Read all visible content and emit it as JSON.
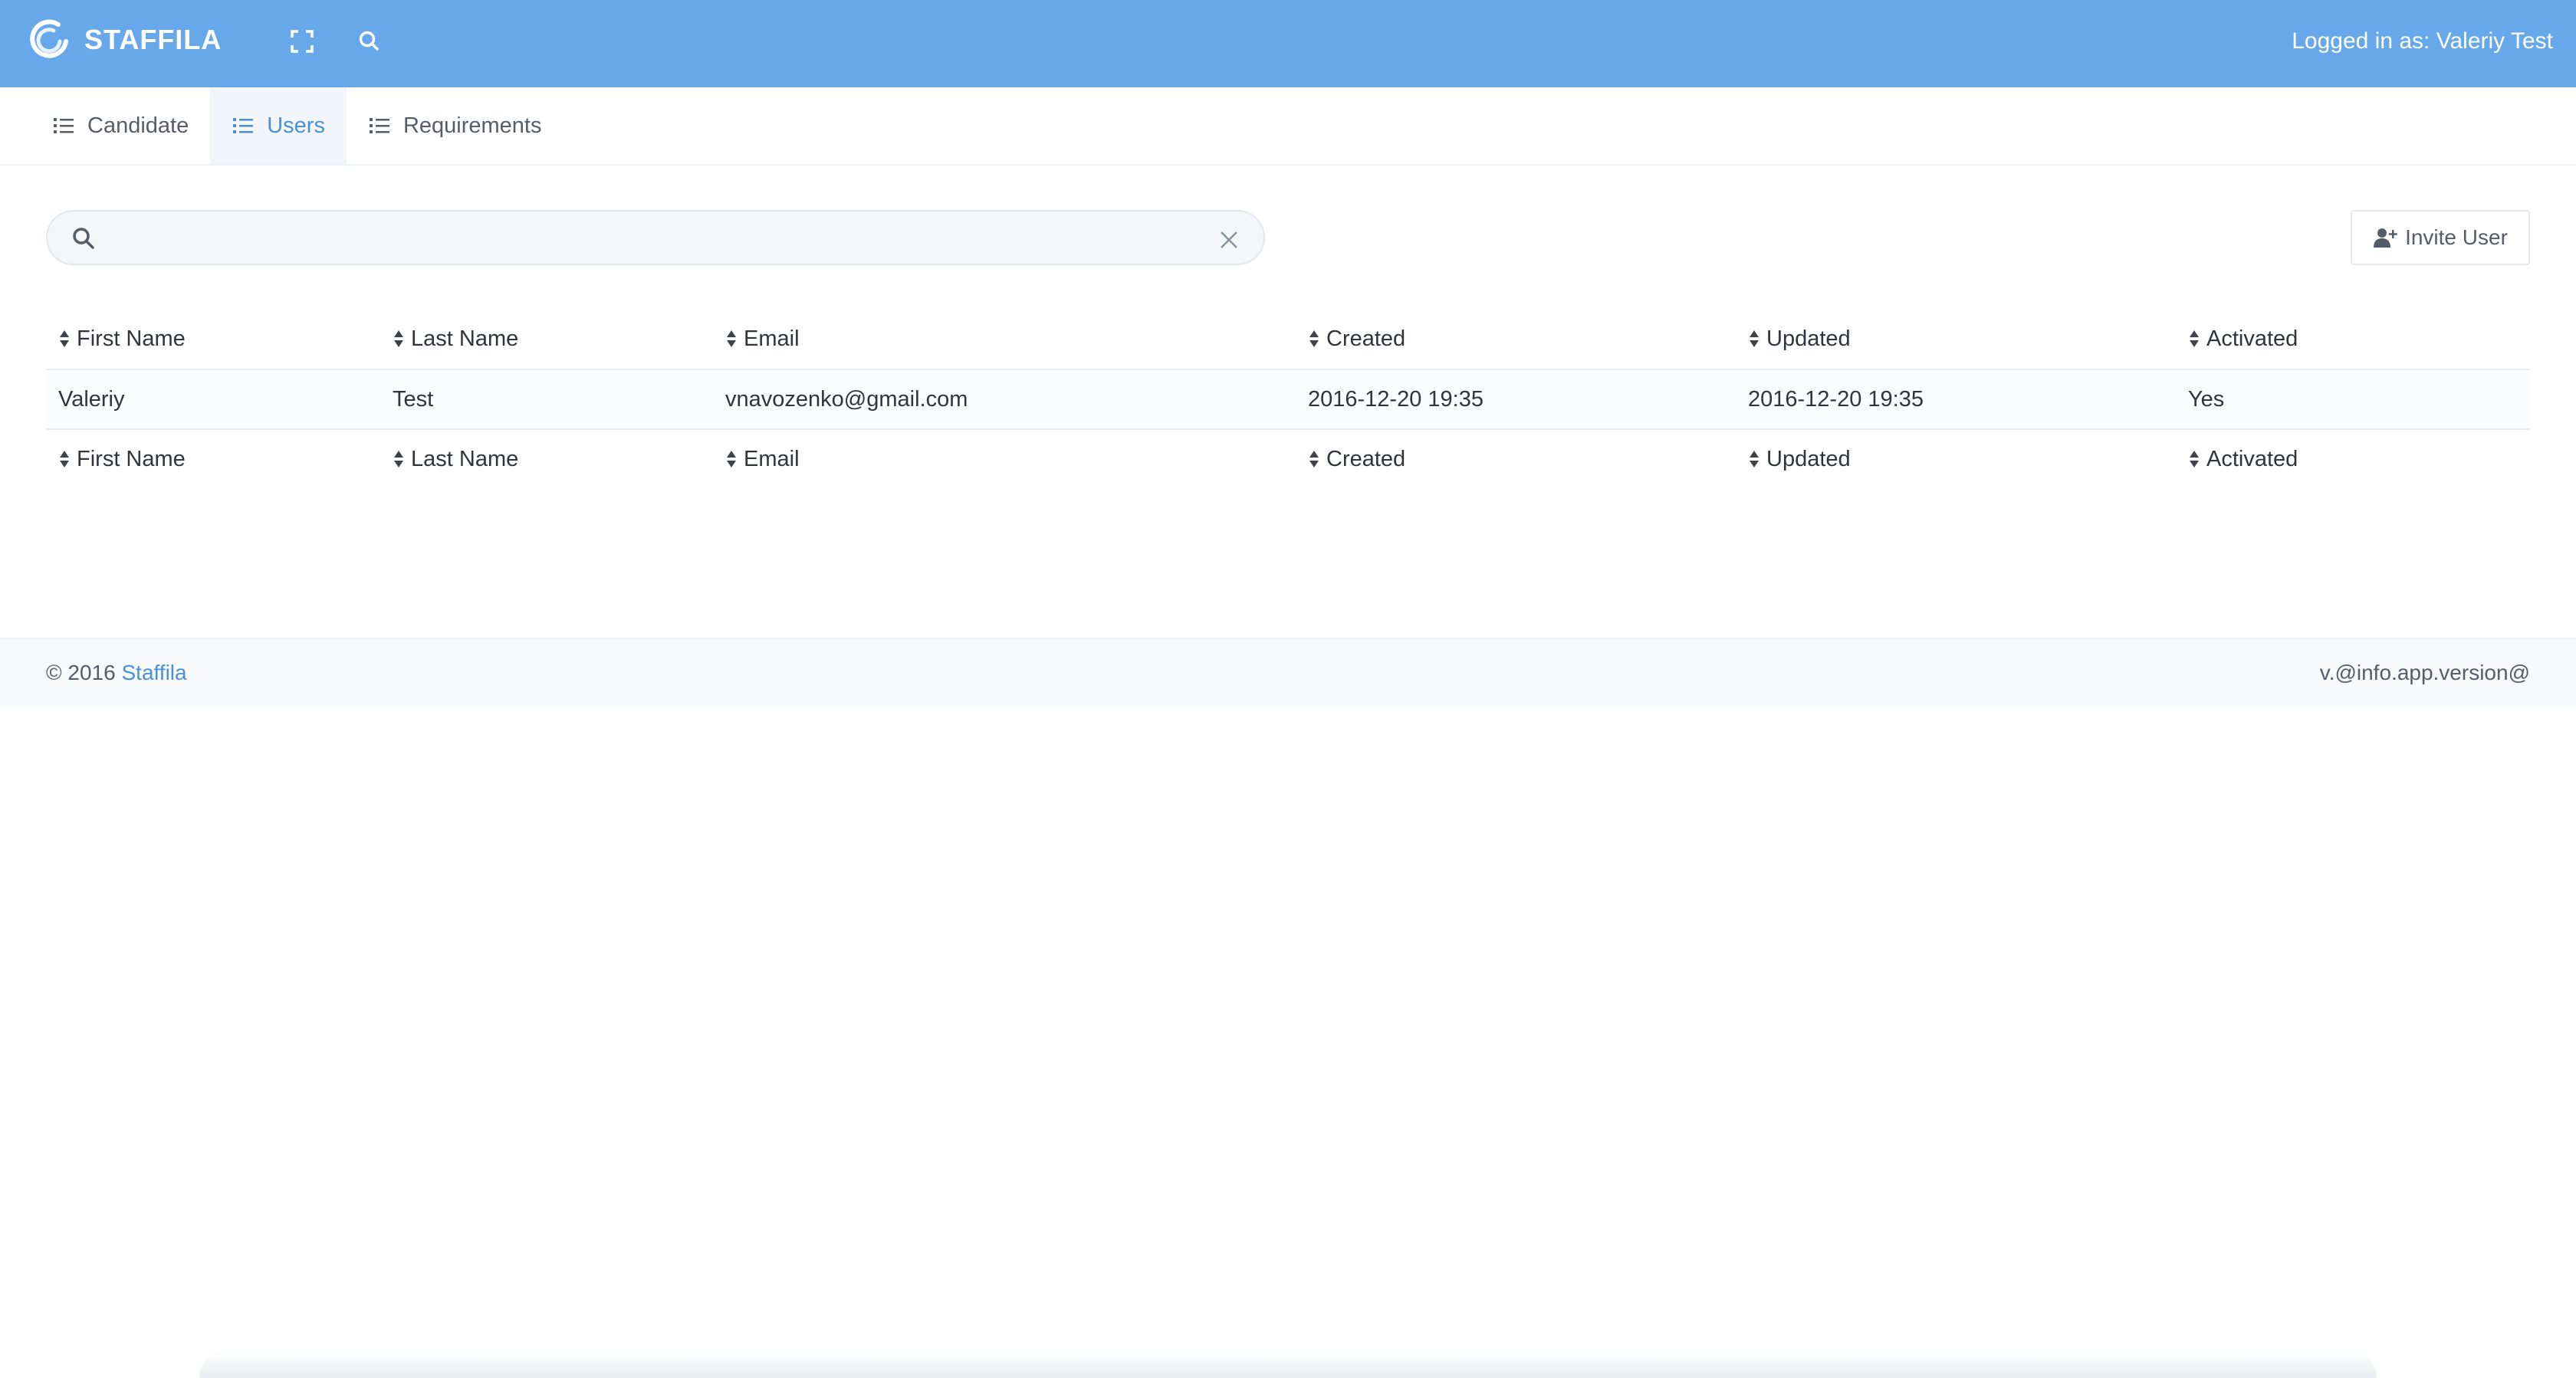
{
  "header": {
    "brand": "STAFFILA",
    "logged_in_text": "Logged in as: Valeriy Test",
    "bg_color": "#67a8ea"
  },
  "tabs": [
    {
      "label": "Candidate",
      "icon": "list-icon",
      "active": false
    },
    {
      "label": "Users",
      "icon": "list-icon",
      "active": true
    },
    {
      "label": "Requirements",
      "icon": "list-icon",
      "active": false
    }
  ],
  "search": {
    "value": "",
    "placeholder": ""
  },
  "toolbar": {
    "invite_label": "Invite User"
  },
  "table": {
    "columns": [
      "First Name",
      "Last Name",
      "Email",
      "Created",
      "Updated",
      "Activated"
    ],
    "rows": [
      [
        "Valeriy",
        "Test",
        "vnavozenko@gmail.com",
        "2016-12-20 19:35",
        "2016-12-20 19:35",
        "Yes"
      ]
    ]
  },
  "footer": {
    "copyright_prefix": "© 2016",
    "link_label": "Staffila",
    "version": "v.@info.app.version@"
  },
  "colors": {
    "accent": "#4a90d9",
    "header": "#67a8ea"
  }
}
